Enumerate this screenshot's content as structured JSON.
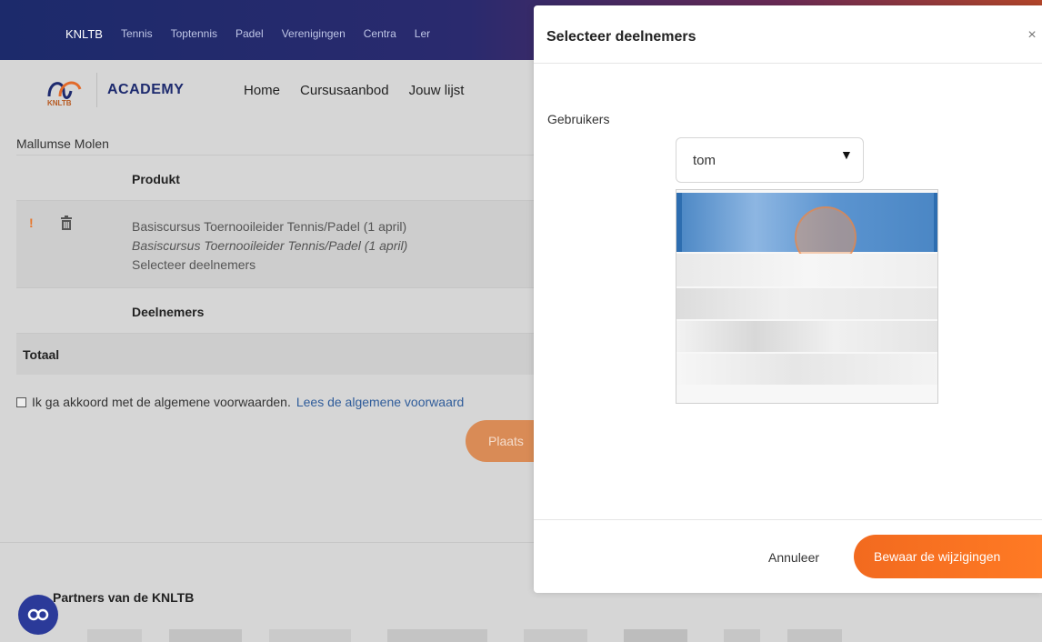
{
  "topnav": {
    "items": [
      "KNLTB",
      "Tennis",
      "Toptennis",
      "Padel",
      "Verenigingen",
      "Centra",
      "Ler"
    ]
  },
  "academy": {
    "logo_text": "KNLTB",
    "label": "ACADEMY",
    "nav": [
      "Home",
      "Cursusaanbod",
      "Jouw lijst"
    ]
  },
  "page": {
    "club": "Mallumse Molen",
    "table": {
      "header": "Produkt",
      "item": {
        "warning": "!",
        "line1": "Basiscursus Toernooileider Tennis/Padel (1 april)",
        "line2": "Basiscursus Toernooileider Tennis/Padel (1 april)",
        "line3": "Selecteer deelnemers"
      },
      "participants": "Deelnemers",
      "total": "Totaal"
    },
    "agree_text": "Ik ga akkoord met de algemene voorwaarden.",
    "agree_link": "Lees de algemene voorwaard",
    "place_button": "Plaats",
    "partners_title": "Partners van de KNLTB"
  },
  "modal": {
    "title": "Selecteer deelnemers",
    "close": "×",
    "users_label": "Gebruikers",
    "select_value": "tom",
    "select_arrow": "▼",
    "cancel": "Annuleer",
    "save": "Bewaar de wijzigingen"
  },
  "colors": {
    "accent_orange": "#f26a1f",
    "nav_blue": "#1c2a6b",
    "link_blue": "#2f5c9a",
    "selected_option": "#4a86c4"
  },
  "icons": [
    "trash-icon",
    "close-icon",
    "dropdown-arrow-icon",
    "knltb-logo",
    "chat-icon"
  ]
}
